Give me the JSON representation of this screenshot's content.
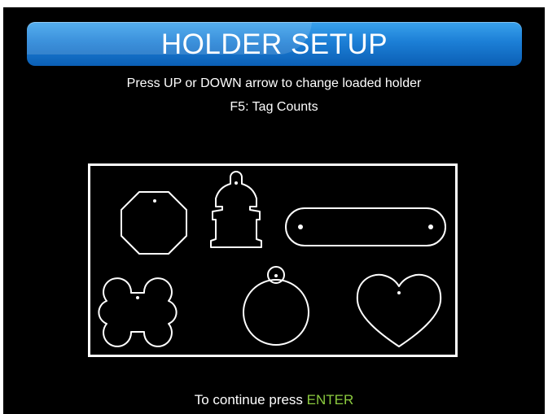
{
  "header": {
    "title": "HOLDER SETUP"
  },
  "instructions": {
    "line1": "Press UP or DOWN arrow to change loaded holder",
    "line2": "F5: Tag Counts"
  },
  "holder": {
    "shapes": [
      {
        "name": "octagon",
        "icon": "octagon-tag-icon"
      },
      {
        "name": "hydrant",
        "icon": "fire-hydrant-tag-icon"
      },
      {
        "name": "rounded-bar",
        "icon": "bar-tag-icon"
      },
      {
        "name": "bone",
        "icon": "bone-tag-icon"
      },
      {
        "name": "circle",
        "icon": "circle-tag-icon"
      },
      {
        "name": "heart",
        "icon": "heart-tag-icon"
      }
    ]
  },
  "footer": {
    "prefix": "To continue press",
    "key": "ENTER"
  },
  "colors": {
    "background": "#000000",
    "title_bar": "#1c7fd6",
    "text": "#ffffff",
    "key_highlight": "#8ccb3f"
  }
}
